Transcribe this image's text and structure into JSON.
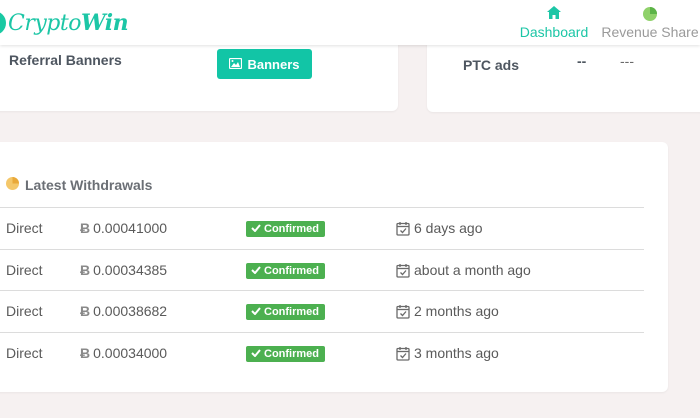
{
  "header": {
    "logo_prefix": "Crypto",
    "logo_suffix": "Win",
    "nav": [
      {
        "label": "Dashboard",
        "icon": "home-icon",
        "active": true
      },
      {
        "label": "Revenue Share",
        "icon": "pie-chart-icon",
        "active": false
      }
    ]
  },
  "referral": {
    "label": "Referral Banners",
    "button_label": "Banners"
  },
  "ptc": {
    "label": "PTC ads",
    "value_1": "--",
    "value_2": "---"
  },
  "withdrawals": {
    "title": "Latest Withdrawals",
    "currency_symbol": "Ƀ",
    "rows": [
      {
        "method": "Direct",
        "amount": "0.00041000",
        "status": "Confirmed",
        "time": "6 days ago"
      },
      {
        "method": "Direct",
        "amount": "0.00034385",
        "status": "Confirmed",
        "time": "about a month ago"
      },
      {
        "method": "Direct",
        "amount": "0.00038682",
        "status": "Confirmed",
        "time": "2 months ago"
      },
      {
        "method": "Direct",
        "amount": "0.00034000",
        "status": "Confirmed",
        "time": "3 months ago"
      }
    ]
  },
  "colors": {
    "accent": "#1cc6a6",
    "confirmed": "#4cb050",
    "background": "#f6f1f1"
  }
}
